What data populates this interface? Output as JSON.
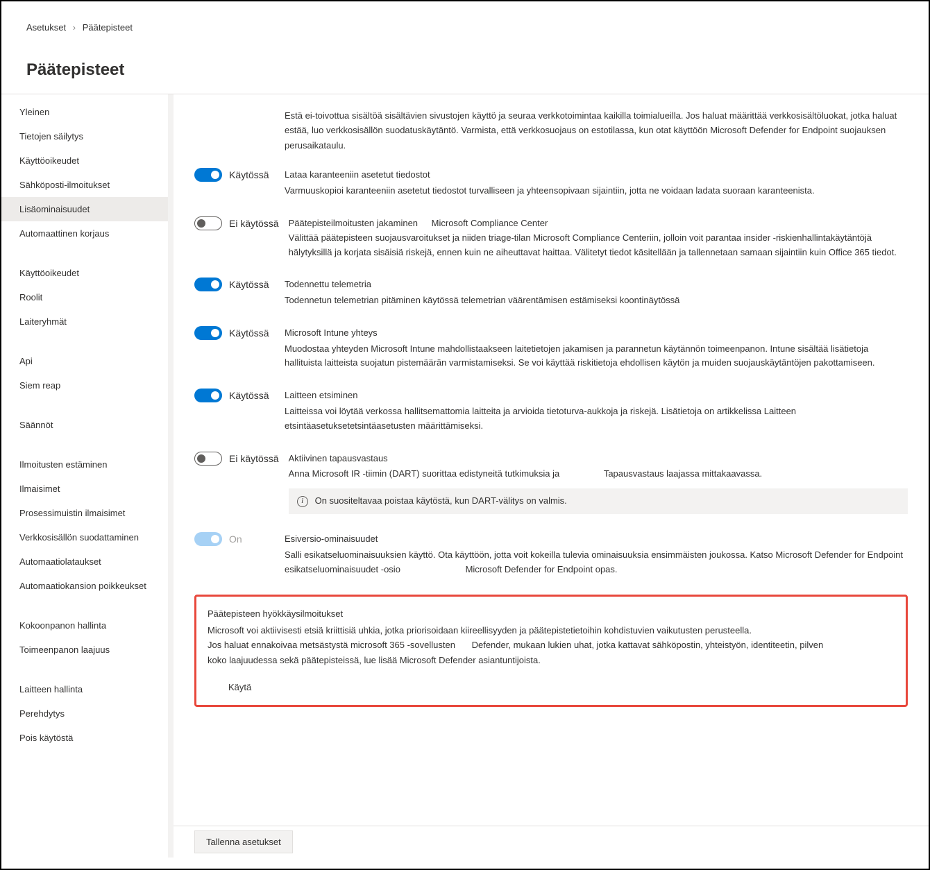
{
  "breadcrumb": {
    "root": "Asetukset",
    "current": "Päätepisteet"
  },
  "page_title": "Päätepisteet",
  "sidebar": {
    "items": [
      {
        "label": "Yleinen"
      },
      {
        "label": "Tietojen säilytys"
      },
      {
        "label": "Käyttöoikeudet"
      },
      {
        "label": "Sähköposti-ilmoitukset"
      },
      {
        "label": "Lisäominaisuudet",
        "active": true
      },
      {
        "label": "Automaattinen korjaus"
      },
      {
        "label": "Käyttöoikeudet",
        "spacer_before": true
      },
      {
        "label": "Roolit"
      },
      {
        "label": "Laiteryhmät"
      },
      {
        "label": "Api",
        "spacer_before": true
      },
      {
        "label": "Siem reap"
      },
      {
        "label": "Säännöt",
        "spacer_before": true
      },
      {
        "label": "Ilmoitusten estäminen",
        "spacer_before": true
      },
      {
        "label": "Ilmaisimet"
      },
      {
        "label": "Prosessimuistin ilmaisimet"
      },
      {
        "label": "Verkkosisällön suodattaminen"
      },
      {
        "label": "Automaatiolataukset"
      },
      {
        "label": "Automaatiokansion poikkeukset"
      },
      {
        "label": "Kokoonpanon hallinta",
        "spacer_before": true
      },
      {
        "label": "Toimeenpanon laajuus"
      },
      {
        "label": "Laitteen hallinta",
        "spacer_before": true
      },
      {
        "label": "Perehdytys"
      },
      {
        "label": "Pois käytöstä"
      }
    ]
  },
  "intro": "Estä ei-toivottua sisältöä sisältävien sivustojen käyttö ja seuraa verkkotoimintaa kaikilla toimialueilla. Jos haluat määrittää verkkosisältöluokat, jotka haluat estää, luo verkkosisällön suodatuskäytäntö. Varmista, että verkkosuojaus on estotilassa, kun otat käyttöön Microsoft Defender for Endpoint suojauksen perusaikataulu.",
  "toggle_states": {
    "on": "Käytössä",
    "off": "Ei käytössä",
    "on_en": "On"
  },
  "settings": [
    {
      "state": "on",
      "title": "Lataa karanteeniin asetetut tiedostot",
      "desc": "Varmuuskopioi karanteeniin asetetut tiedostot turvalliseen ja yhteensopivaan sijaintiin, jotta ne voidaan ladata suoraan karanteenista."
    },
    {
      "state": "off",
      "title": "Päätepisteilmoitusten jakaminen",
      "title_extra": "Microsoft Compliance Center",
      "desc": "Välittää päätepisteen suojausvaroitukset ja niiden triage-tilan Microsoft Compliance Centeriin, jolloin voit parantaa insider -riskienhallintakäytäntöjä hälytyksillä ja korjata sisäisiä riskejä, ennen kuin ne aiheuttavat haittaa. Välitetyt tiedot käsitellään ja tallennetaan samaan sijaintiin kuin Office 365 tiedot."
    },
    {
      "state": "on",
      "title": "Todennettu telemetria",
      "desc": "Todennetun telemetrian pitäminen käytössä telemetrian väärentämisen estämiseksi koontinäytössä"
    },
    {
      "state": "on",
      "title": "Microsoft Intune yhteys",
      "desc": "Muodostaa yhteyden Microsoft Intune mahdollistaakseen laitetietojen jakamisen ja parannetun käytännön toimeenpanon. Intune sisältää lisätietoja hallituista laitteista suojatun pistemäärän varmistamiseksi. Se voi käyttää riskitietoja ehdollisen käytön ja muiden suojauskäytäntöjen pakottamiseen."
    },
    {
      "state": "on",
      "title": "Laitteen etsiminen",
      "desc": "Laitteissa voi löytää verkossa hallitsemattomia laitteita ja arvioida tietoturva-aukkoja ja riskejä. Lisätietoja on artikkelissa Laitteen etsintäasetuksetetsintäasetusten määrittämiseksi."
    },
    {
      "state": "off",
      "title": "Aktiivinen tapausvastaus",
      "desc_line1": "Anna Microsoft IR -tiimin (DART) suorittaa edistyneitä tutkimuksia ja",
      "desc_right": "Tapausvastaus laajassa mittakaavassa.",
      "banner": "On suositeltavaa poistaa käytöstä, kun DART-välitys on valmis."
    },
    {
      "state": "on_disabled",
      "title": "Esiversio-ominaisuudet",
      "desc": "Salli esikatseluominaisuuksien käyttö. Ota käyttöön, jotta voit kokeilla tulevia ominaisuuksia ensimmäisten joukossa. Katso Microsoft Defender for Endpoint esikatseluominaisuudet -osio",
      "desc_right": "Microsoft Defender for Endpoint opas."
    }
  ],
  "highlight": {
    "title": "Päätepisteen hyökkäysilmoitukset",
    "line1": "Microsoft voi aktiivisesti etsiä kriittisiä uhkia, jotka priorisoidaan kiireellisyyden ja päätepistetietoihin kohdistuvien vaikutusten perusteella.",
    "line2a": "Jos haluat ennakoivaa metsästystä microsoft 365 -sovellusten",
    "line2b": "Defender, mukaan lukien uhat, jotka kattavat sähköpostin, yhteistyön, identiteetin, pilven",
    "line3": "koko laajuudessa sekä päätepisteissä, lue lisää Microsoft Defender asiantuntijoista.",
    "apply": "Käytä"
  },
  "footer": {
    "save": "Tallenna asetukset"
  }
}
